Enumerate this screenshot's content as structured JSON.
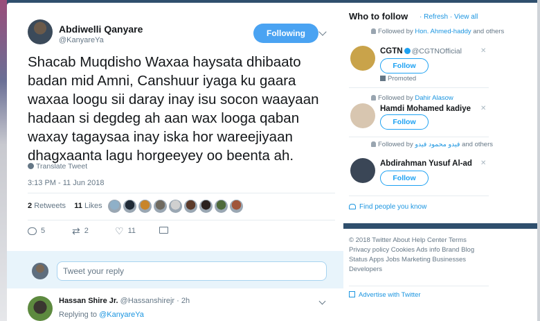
{
  "tweet": {
    "author_name": "Abdiwelli Qanyare",
    "author_handle": "@KanyareYa",
    "follow_label": "Following",
    "text": "Shacab Muqdisho Waxaa haysata dhibaato\nbadan mid Amni, Canshuur iyaga ku gaara\nwaxaa loogu sii daray inay isu socon waayaan\nhadaan si degdeg ah aan wax looga qaban\nwaxay tagaysaa inay iska hor wareejiyaan\ndhagxaanta lagu horgeeyey oo beenta ah.",
    "translate_label": "Translate Tweet",
    "timestamp": "3:13 PM - 11 Jun 2018",
    "retweets_count": "2",
    "retweets_label": "Retweets",
    "likes_count": "11",
    "likes_label": "Likes",
    "likers_colors": [
      "#8fb0c8",
      "#1f2a36",
      "#c8852a",
      "#6f6a60",
      "#d0d0d0",
      "#5b3a2a",
      "#2a2220",
      "#4e6a3a",
      "#a0553a"
    ],
    "actions": {
      "reply_count": "5",
      "retweet_count": "2",
      "like_count": "11"
    }
  },
  "reply_box": {
    "placeholder": "Tweet your reply"
  },
  "reply": {
    "name": "Hassan Shire Jr.",
    "handle": "@Hassanshirejr",
    "time": "· 2h",
    "replying_prefix": "Replying to",
    "replying_to": "@KanyareYa"
  },
  "sidebar": {
    "title": "Who to follow",
    "links": "· Refresh · View all",
    "suggestions": [
      {
        "context_prefix": "Followed by",
        "context_name": "Hon. Ahmed-haddy",
        "context_suffix": "and others",
        "name": "CGTN",
        "handle": "@CGTNOfficial",
        "follow_label": "Follow",
        "promoted": "Promoted",
        "avatar_color": "#c9a34a"
      },
      {
        "context_prefix": "Followed by",
        "context_name": "Dahir Alasow",
        "context_suffix": "",
        "name": "Hamdi Mohamed kadiye",
        "handle": "",
        "follow_label": "Follow",
        "avatar_color": "#d8c6b0"
      },
      {
        "context_prefix": "Followed by",
        "context_name": "فيدو محمود فيدو",
        "context_suffix": "and others",
        "name": "Abdirahman Yusuf Al-ad",
        "handle": "",
        "follow_label": "Follow",
        "avatar_color": "#3a4656"
      }
    ],
    "find_people": "Find people you know",
    "footer": "© 2018 Twitter  About  Help Center  Terms  Privacy policy  Cookies  Ads info  Brand  Blog  Status  Apps  Jobs  Marketing  Businesses  Developers",
    "advertise": "Advertise with Twitter"
  }
}
